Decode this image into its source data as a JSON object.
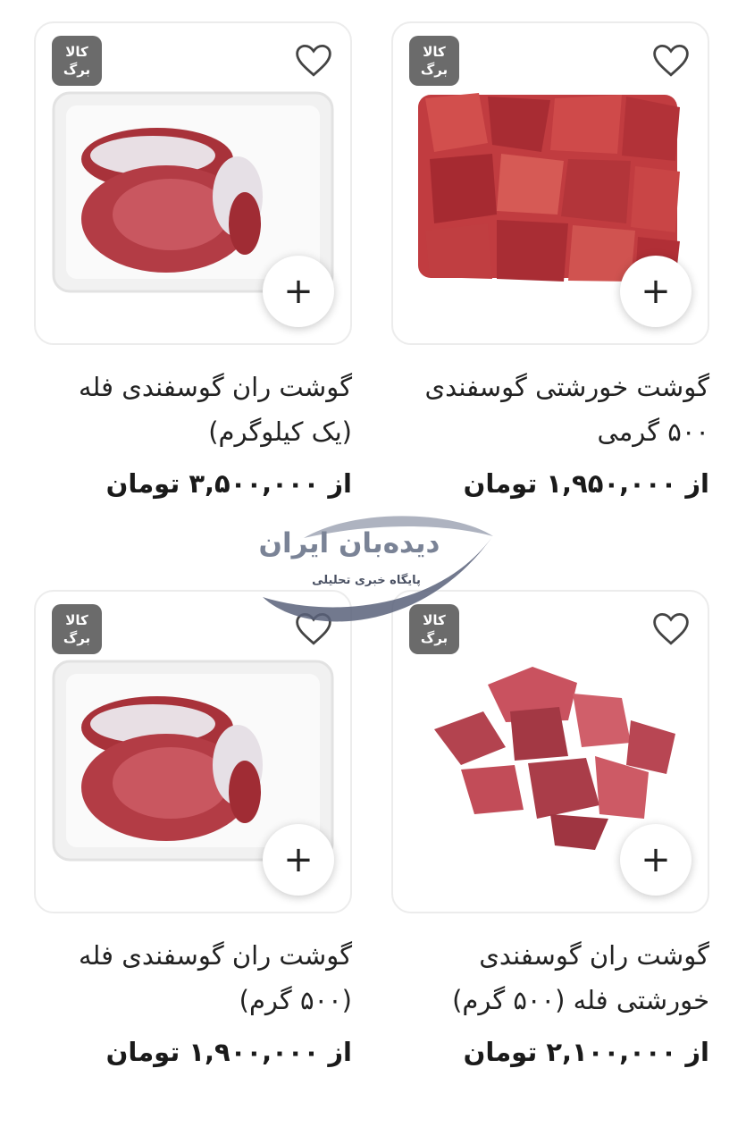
{
  "products": [
    {
      "badge_line1": "کالا",
      "badge_line2": "برگ",
      "title_line1": "گوشت خورشتی گوسفندی",
      "title_line2": "۵۰۰ گرمی",
      "price": "از ۱,۹۵۰,۰۰۰ تومان",
      "add_symbol": "+"
    },
    {
      "badge_line1": "کالا",
      "badge_line2": "برگ",
      "title_line1": "گوشت ران گوسفندی فله",
      "title_line2": "(یک کیلوگرم)",
      "price": "از ۳,۵۰۰,۰۰۰ تومان",
      "add_symbol": "+"
    },
    {
      "badge_line1": "کالا",
      "badge_line2": "برگ",
      "title_line1": "گوشت ران گوسفندی",
      "title_line2": "خورشتی فله (۵۰۰ گرم)",
      "price": "از ۲,۱۰۰,۰۰۰ تومان",
      "add_symbol": "+"
    },
    {
      "badge_line1": "کالا",
      "badge_line2": "برگ",
      "title_line1": "گوشت ران گوسفندی فله",
      "title_line2": "(۵۰۰ گرم)",
      "price": "از ۱,۹۰۰,۰۰۰ تومان",
      "add_symbol": "+"
    }
  ],
  "watermark": {
    "name": "دیده‌بان ایران",
    "tagline": "پایگاه خبری تحلیلی"
  },
  "colors": {
    "badge": "#6b6b6b",
    "border": "#ececec",
    "meat": "#b8343a"
  },
  "icons": [
    "heart-icon",
    "plus-icon",
    "brand-badge"
  ]
}
